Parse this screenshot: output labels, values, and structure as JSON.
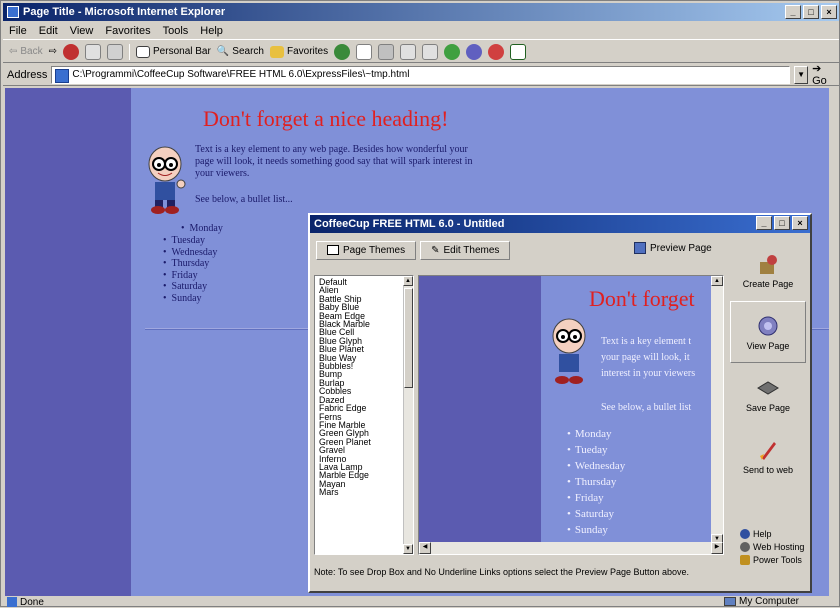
{
  "browser": {
    "title": "Page Title - Microsoft Internet Explorer",
    "menu": [
      "File",
      "Edit",
      "View",
      "Favorites",
      "Tools",
      "Help"
    ],
    "toolbar": {
      "back": "Back",
      "personal_bar": "Personal Bar",
      "search": "Search",
      "favorites": "Favorites"
    },
    "address_label": "Address",
    "address_value": "C:\\Programmi\\CoffeeCup Software\\FREE HTML 6.0\\ExpressFiles\\~tmp.html",
    "go_label": "Go",
    "status": "Done",
    "zone": "My Computer"
  },
  "page": {
    "heading": "Don't forget a nice heading!",
    "text_lines": [
      "Text is a key element to any web page. Besides how wonderful your",
      "page will look, it needs something good say that will spark interest in",
      "your viewers."
    ],
    "see_below": "See below, a bullet list...",
    "days": [
      "Monday",
      "Tuesday",
      "Wednesday",
      "Thursday",
      "Friday",
      "Saturday",
      "Sunday"
    ]
  },
  "dialog": {
    "title": "CoffeeCup FREE HTML 6.0 - Untitled",
    "tabs": {
      "page_themes": "Page Themes",
      "edit_themes": "Edit Themes",
      "preview_page": "Preview Page"
    },
    "themes": [
      "Default",
      "Alien",
      "Battle Ship",
      "Baby Blue",
      "Beam Edge",
      "Black Marble",
      "Blue Cell",
      "Blue Glyph",
      "Blue Planet",
      "Blue Way",
      "Bubbles!",
      "Bump",
      "Burlap",
      "Cobbles",
      "Dazed",
      "Fabric Edge",
      "Ferns",
      "Fine Marble",
      "Green Glyph",
      "Green Planet",
      "Gravel",
      "Inferno",
      "Lava Lamp",
      "Marble Edge",
      "Mayan",
      "Mars"
    ],
    "preview": {
      "heading": "Don't forget",
      "text_lines": [
        "Text is a key element t",
        "your page will look, it",
        "interest in your viewers"
      ],
      "see_below": "See below, a bullet list",
      "days": [
        "Monday",
        "Tueday",
        "Wednesday",
        "Thursday",
        "Friday",
        "Saturday",
        "Sunday"
      ]
    },
    "tools": [
      "Create Page",
      "View Page",
      "Save Page",
      "Send to web"
    ],
    "links": [
      "Help",
      "Web Hosting",
      "Power Tools"
    ],
    "note": "Note: To see Drop Box and No Underline Links options select the Preview Page Button above."
  },
  "colors": {
    "page_bg": "#8090d8",
    "band": "#5b5bb0",
    "heading_red": "#e02020",
    "title_blue": "#0a246a"
  }
}
